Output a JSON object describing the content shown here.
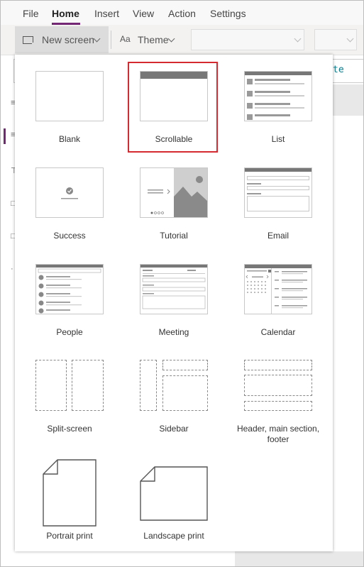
{
  "menu": {
    "items": [
      {
        "label": "File"
      },
      {
        "label": "Home"
      },
      {
        "label": "Insert"
      },
      {
        "label": "View"
      },
      {
        "label": "Action"
      },
      {
        "label": "Settings"
      }
    ],
    "active": "Home"
  },
  "toolbar": {
    "new_screen_label": "New screen",
    "theme_label": "Theme",
    "theme_icon": "Aa"
  },
  "formula": {
    "text": "te"
  },
  "flyout": {
    "selected": "Scrollable",
    "templates": [
      {
        "label": "Blank"
      },
      {
        "label": "Scrollable"
      },
      {
        "label": "List"
      },
      {
        "label": "Success"
      },
      {
        "label": "Tutorial"
      },
      {
        "label": "Email"
      },
      {
        "label": "People"
      },
      {
        "label": "Meeting"
      },
      {
        "label": "Calendar"
      },
      {
        "label": "Split-screen"
      },
      {
        "label": "Sidebar"
      },
      {
        "label": "Header, main section, footer"
      },
      {
        "label": "Portrait print"
      },
      {
        "label": "Landscape print"
      }
    ]
  },
  "colors": {
    "accent": "#742774",
    "selection": "#d52b30"
  }
}
